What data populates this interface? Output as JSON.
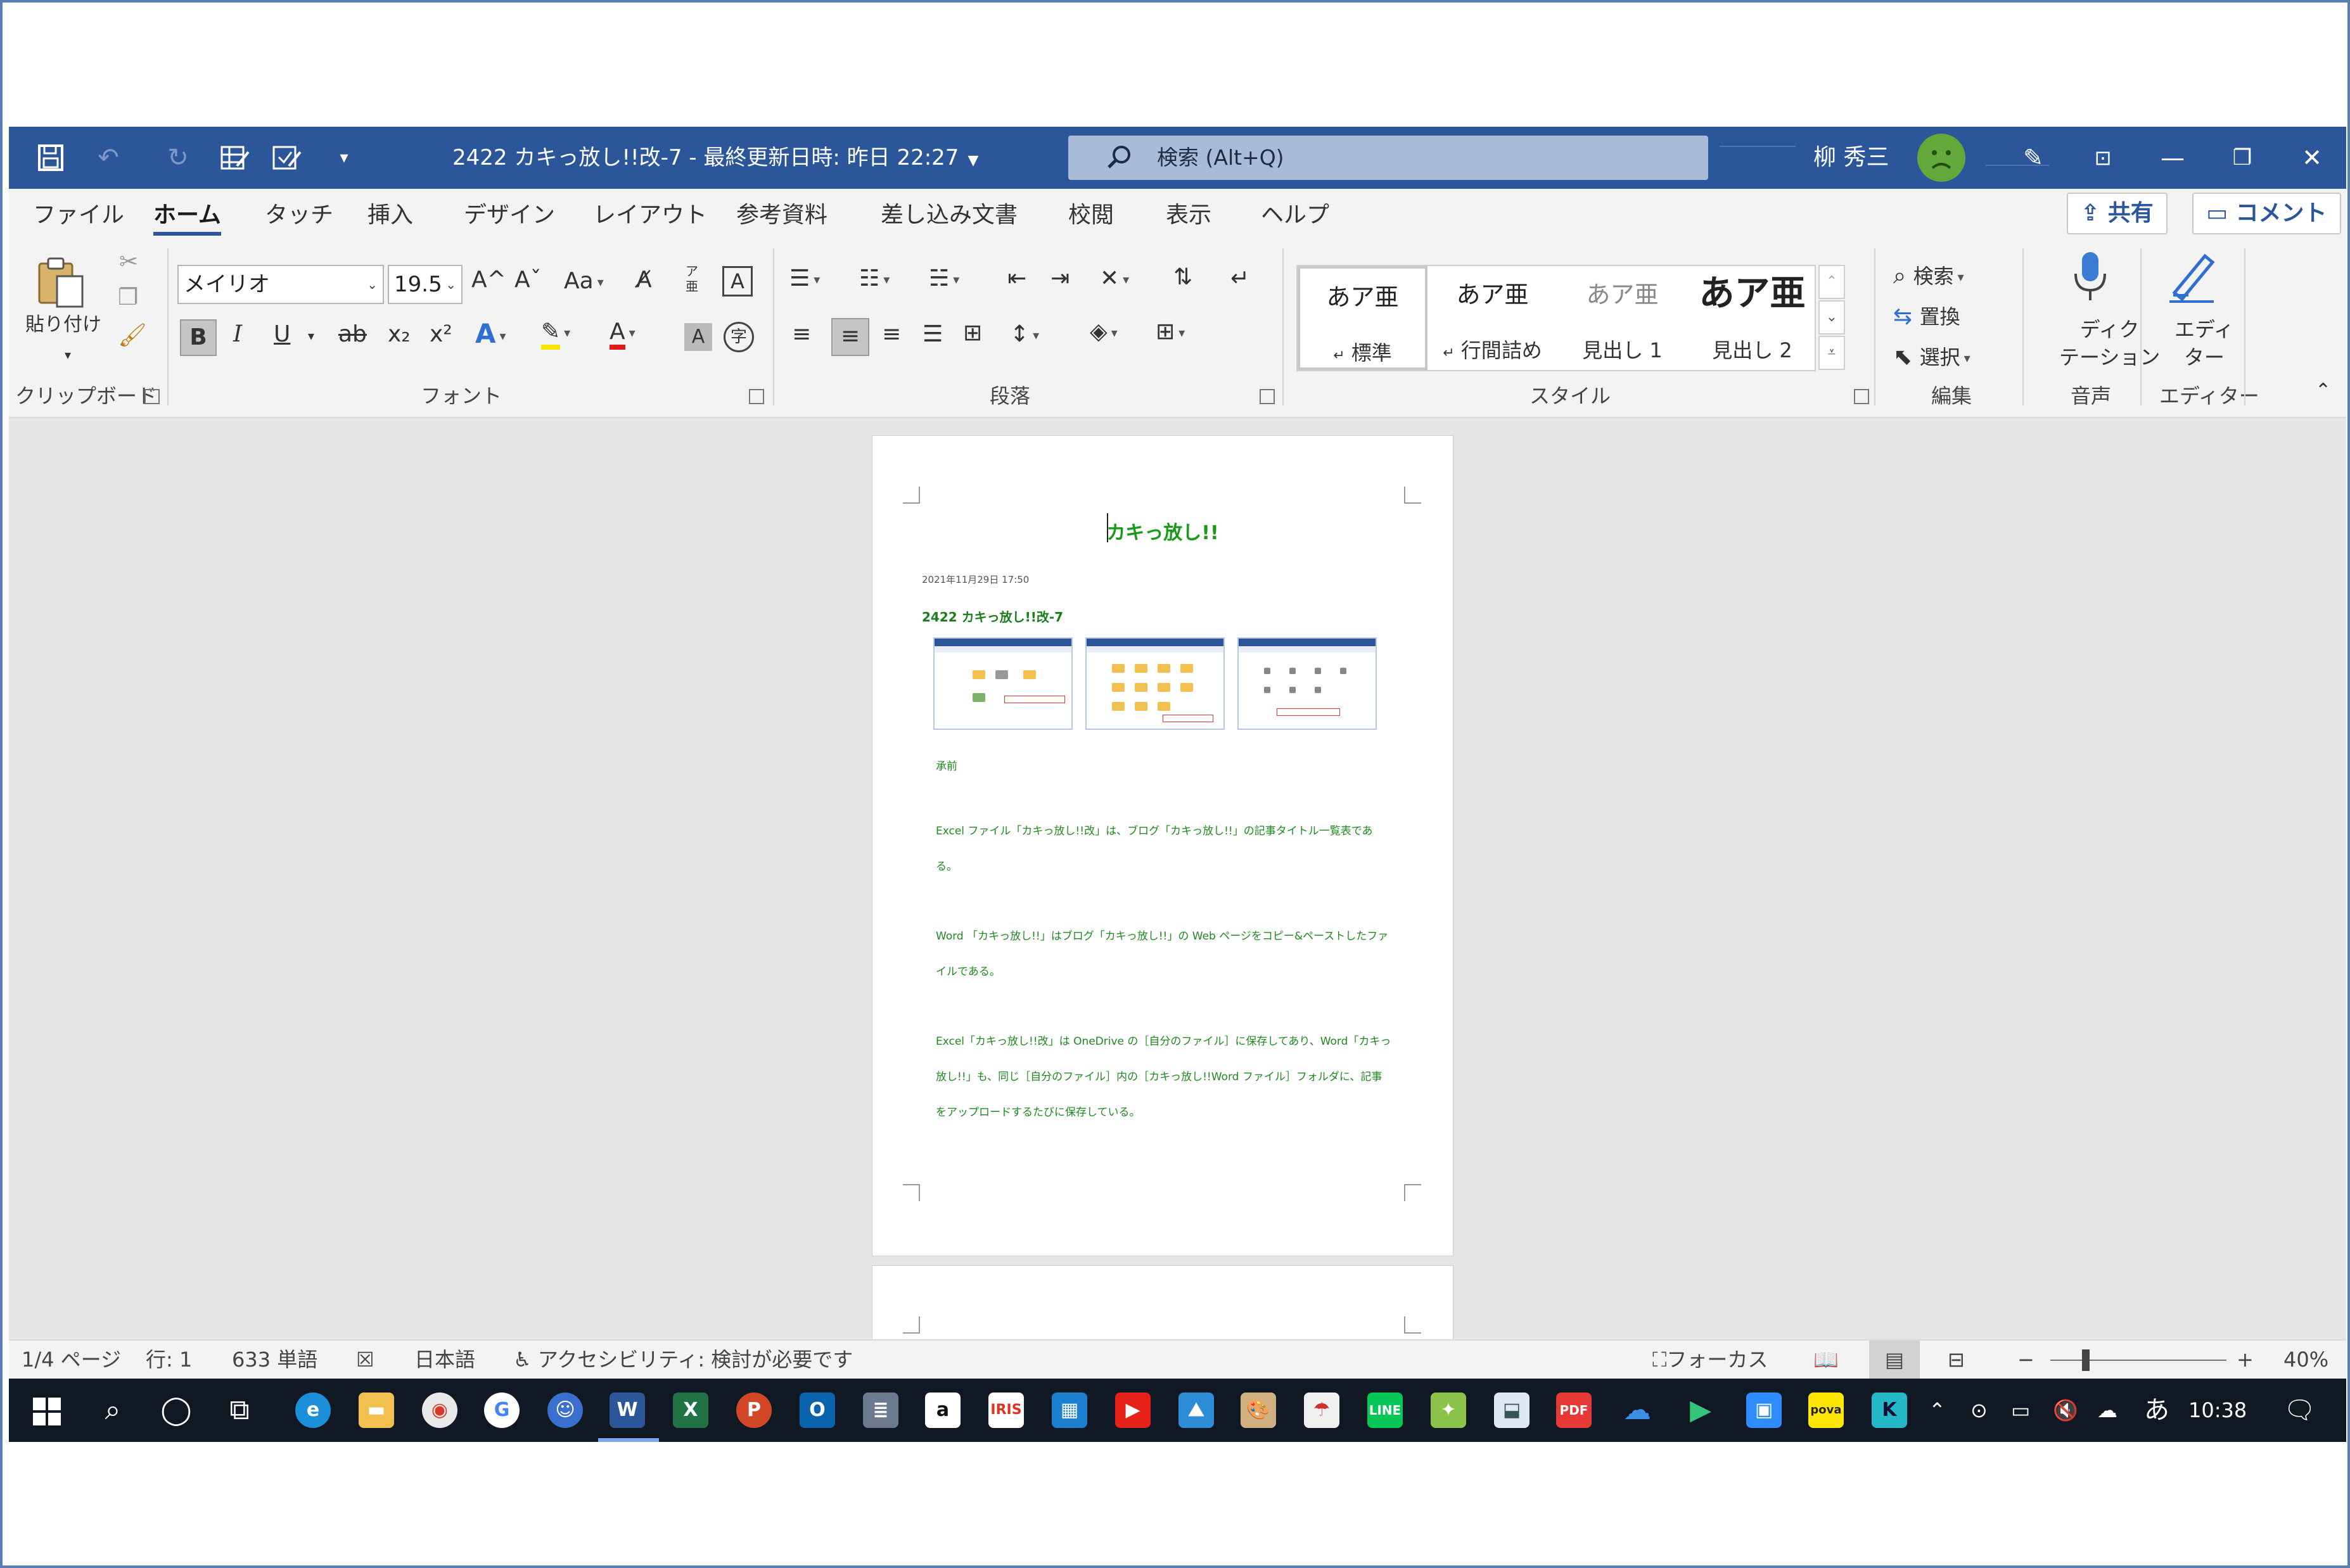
{
  "titlebar": {
    "doc_title": "2422 カキっ放し!!改-7 - 最終更新日時: 昨日 22:27",
    "search_placeholder": "検索 (Alt+Q)",
    "user_name": "柳 秀三"
  },
  "tabs": [
    "ファイル",
    "ホーム",
    "タッチ",
    "挿入",
    "デザイン",
    "レイアウト",
    "参考資料",
    "差し込み文書",
    "校閲",
    "表示",
    "ヘルプ"
  ],
  "active_tab": "ホーム",
  "header_buttons": {
    "share": "共有",
    "comment": "コメント"
  },
  "ribbon": {
    "clipboard": {
      "label": "クリップボード",
      "paste": "貼り付け"
    },
    "font": {
      "label": "フォント",
      "font_name": "メイリオ",
      "font_size": "19.5",
      "change_case": "Aa",
      "bold": "B",
      "italic": "I",
      "underline": "U",
      "strike": "ab",
      "subscript": "x₂",
      "superscript": "x²",
      "phonetic_top": "ア",
      "phonetic_bottom": "亜",
      "phonetic_circle": "字",
      "font_color_letter": "A",
      "grow": "A^",
      "shrink": "Aˇ"
    },
    "paragraph": {
      "label": "段落"
    },
    "styles": {
      "label": "スタイル",
      "items": [
        {
          "sample": "あア亜",
          "name": "標準",
          "mark": "↵"
        },
        {
          "sample": "あア亜",
          "name": "行間詰め",
          "mark": "↵"
        },
        {
          "sample": "あア亜",
          "name": "見出し 1",
          "mark": ""
        },
        {
          "sample": "あア亜",
          "name": "見出し 2",
          "mark": ""
        }
      ]
    },
    "editing": {
      "label": "編集",
      "find": "検索",
      "replace": "置換",
      "select": "選択"
    },
    "voice": {
      "label": "音声",
      "dictate_line1": "ディク",
      "dictate_line2": "テーション"
    },
    "editor": {
      "label": "エディター",
      "editor_line1": "エディ",
      "editor_line2": "ター"
    }
  },
  "document": {
    "title": "カキっ放し!!",
    "date": "2021年11月29日 17:50",
    "subtitle": "2422 カキっ放し!!改-7",
    "paragraphs": [
      "承前",
      "Excel ファイル「カキっ放し!!改」は、ブログ「カキっ放し!!」の記事タイトル一覧表である。",
      "Word 「カキっ放し!!」はブログ「カキっ放し!!」の Web ページをコピー&ペーストしたファイルである。",
      "Excel「カキっ放し!!改」は OneDrive の［自分のファイル］に保存してあり、Word「カキっ放し!!」も、同じ［自分のファイル］内の［カキっ放し!!Word ファイル］フォルダに、記事をアップロードするたびに保存している。"
    ]
  },
  "statusbar": {
    "page": "1/4 ページ",
    "line": "行: 1",
    "words": "633 単語",
    "language": "日本語",
    "accessibility": "アクセシビリティ: 検討が必要です",
    "focus": "フォーカス",
    "zoom": "40%",
    "zoom_fraction": 0.2
  },
  "taskbar": {
    "time": "10:38",
    "ime": "あ",
    "apps": [
      "edge",
      "explorer",
      "chrome",
      "google",
      "people",
      "word",
      "excel",
      "powerpoint",
      "outlook",
      "app-stack",
      "amazon",
      "iris",
      "news",
      "youtube",
      "photos",
      "paint",
      "umbrella",
      "line",
      "app-green",
      "inbox",
      "pdf",
      "onedrive",
      "play",
      "zoom",
      "pova",
      "k-app"
    ],
    "word_letter": "W",
    "excel_letter": "X",
    "ppt_letter": "P",
    "outlook_letter": "O",
    "amazon_letter": "a",
    "pdf_letter": "PDF",
    "pova_letter": "pova",
    "k_letter": "K"
  },
  "colors": {
    "word_blue": "#2b579a",
    "doc_green": "#179b17",
    "taskbar": "#101824"
  }
}
